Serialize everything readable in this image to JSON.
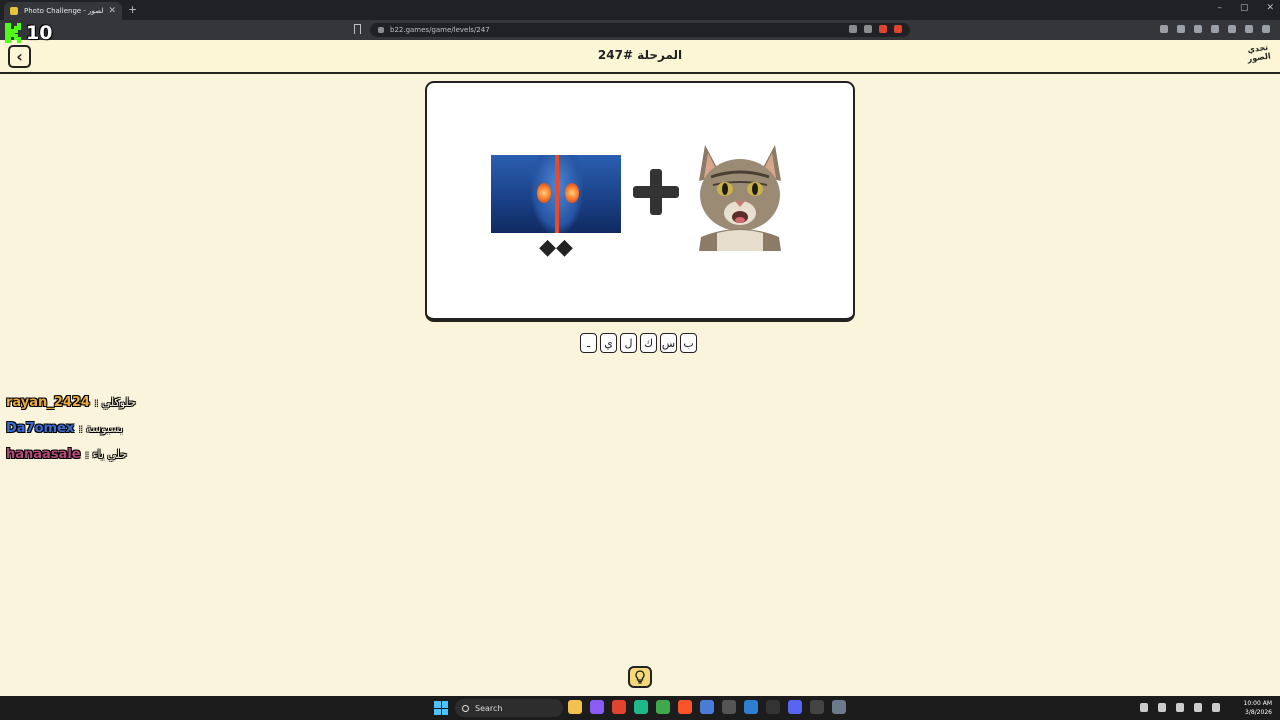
{
  "browser": {
    "tab_title": "Photo Challenge - تحدي الصور",
    "tab_close": "✕",
    "new_tab": "+",
    "url": "b22.games/game/levels/247",
    "window_controls": [
      "–",
      "▢",
      "✕"
    ]
  },
  "overlay": {
    "score": "10"
  },
  "header": {
    "back_icon": "‹",
    "level_title": "المرحلة #247",
    "logo_text": "تحدي الصور"
  },
  "puzzle": {
    "image_left": "kidneys-anatomy",
    "caption_left": "◆◆",
    "operator": "plus-icon",
    "image_right": "cat-face"
  },
  "answer": {
    "slots": [
      "ـ",
      "ي",
      "ل",
      "ك",
      "س",
      "ب"
    ]
  },
  "chat": [
    {
      "user": "rayan_2424",
      "message": ": حلوكلي",
      "color": "#e9a93b"
    },
    {
      "user": "Da7omex",
      "message": ": بسبوسة",
      "color": "#3a6fd8"
    },
    {
      "user": "hanaasale",
      "message": ": حلي ياء",
      "color": "#b54a7a"
    }
  ],
  "hint": {
    "icon": "lightbulb-icon"
  },
  "taskbar": {
    "search_label": "Search",
    "time": "10:00 AM",
    "date": "3/8/2026"
  }
}
